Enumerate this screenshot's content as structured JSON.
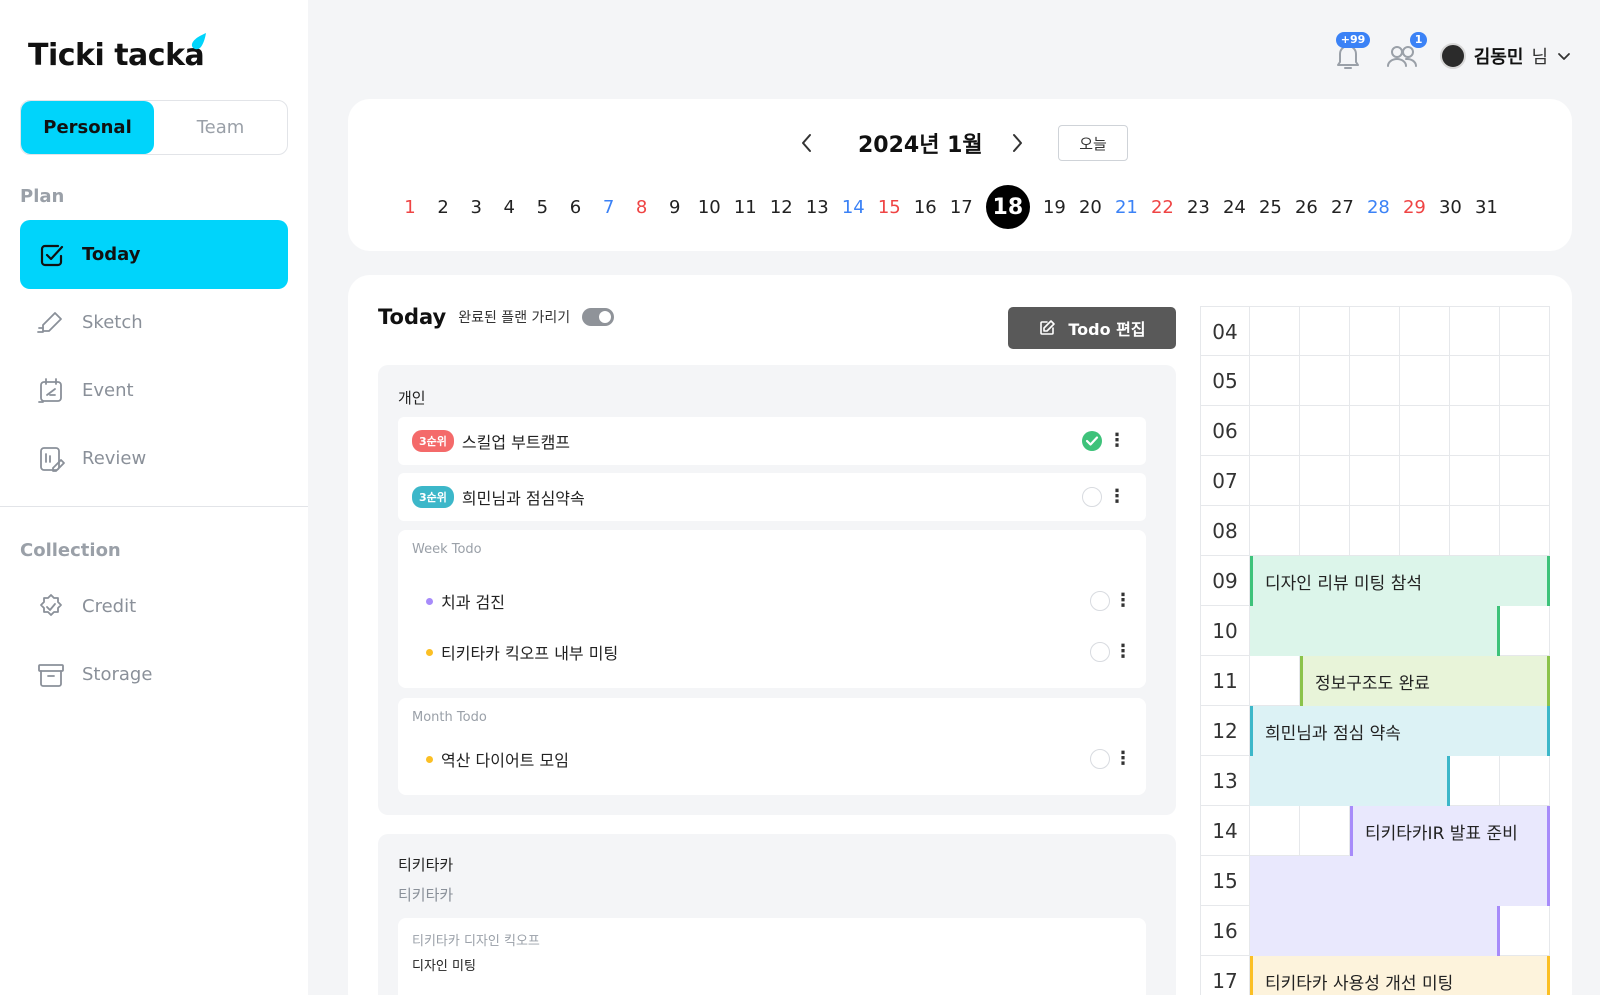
{
  "app": {
    "logo_text": "Ticki tacka"
  },
  "mode_toggle": {
    "personal": "Personal",
    "team": "Team"
  },
  "sidebar": {
    "plan_label": "Plan",
    "plan_items": [
      {
        "label": "Today",
        "icon": "calendar-check-icon",
        "active": true
      },
      {
        "label": "Sketch",
        "icon": "pencil-icon",
        "active": false
      },
      {
        "label": "Event",
        "icon": "calendar-event-icon",
        "active": false
      },
      {
        "label": "Review",
        "icon": "review-icon",
        "active": false
      }
    ],
    "collection_label": "Collection",
    "collection_items": [
      {
        "label": "Credit",
        "icon": "badge-check-icon"
      },
      {
        "label": "Storage",
        "icon": "archive-box-icon"
      }
    ]
  },
  "header": {
    "notification_badge": "+99",
    "friends_badge": "1",
    "user_name": "김동민",
    "user_suffix": "님"
  },
  "calendar": {
    "title": "2024년 1월",
    "today_label": "오늘",
    "selected_day": 18,
    "days": [
      "1",
      "2",
      "3",
      "4",
      "5",
      "6",
      "7",
      "8",
      "9",
      "10",
      "11",
      "12",
      "13",
      "14",
      "15",
      "16",
      "17",
      "18",
      "19",
      "20",
      "21",
      "22",
      "23",
      "24",
      "25",
      "26",
      "27",
      "28",
      "29",
      "30",
      "31"
    ],
    "saturdays": [
      7,
      14,
      21,
      28
    ],
    "sundays": [
      1,
      8,
      15,
      22,
      29
    ]
  },
  "today": {
    "title": "Today",
    "hide_completed_label": "완료된 플랜 가리기",
    "hide_completed_on": true,
    "edit_button": "Todo 편집",
    "personal_group": {
      "title": "개인",
      "todos": [
        {
          "priority": "3순위",
          "priority_color": "#f46a6a",
          "text": "스킬업 부트캠프",
          "done": true
        },
        {
          "priority": "3순위",
          "priority_color": "#3cb7c9",
          "text": "희민님과 점심약속",
          "done": false
        }
      ],
      "week_todo": {
        "title": "Week Todo",
        "items": [
          {
            "text": "치과 검진",
            "dot_color": "#a78bfa"
          },
          {
            "text": "티키타카 킥오프 내부 미팅",
            "dot_color": "#fbbf24"
          }
        ]
      },
      "month_todo": {
        "title": "Month Todo",
        "items": [
          {
            "text": "역산 다이어트 모임",
            "dot_color": "#fbbf24"
          }
        ]
      }
    },
    "team_group": {
      "title": "티키타카",
      "subtitle": "티키타카",
      "card_title": "티키타카 디자인 킥오프",
      "card_item": "디자인 미팅"
    }
  },
  "timeline": {
    "hours": [
      "04",
      "05",
      "06",
      "07",
      "08",
      "09",
      "10",
      "11",
      "12",
      "13",
      "14",
      "15",
      "16",
      "17"
    ],
    "events": [
      {
        "label": "디자인 리뷰 미팅 참석",
        "color": "#dcf5ea",
        "border": "#3ec27a"
      },
      {
        "label": "정보구조도 완료",
        "color": "#e8f4d9",
        "border": "#8bc34a"
      },
      {
        "label": "희민님과 점심 약속",
        "color": "#dcf2f5",
        "border": "#3cb7c9"
      },
      {
        "label": "티키타카IR 발표 준비",
        "color": "#e9e8fd",
        "border": "#a78bfa"
      },
      {
        "label": "티키타카 사용성 개선 미팅",
        "color": "#fdf3dc",
        "border": "#fbbf24"
      }
    ]
  }
}
